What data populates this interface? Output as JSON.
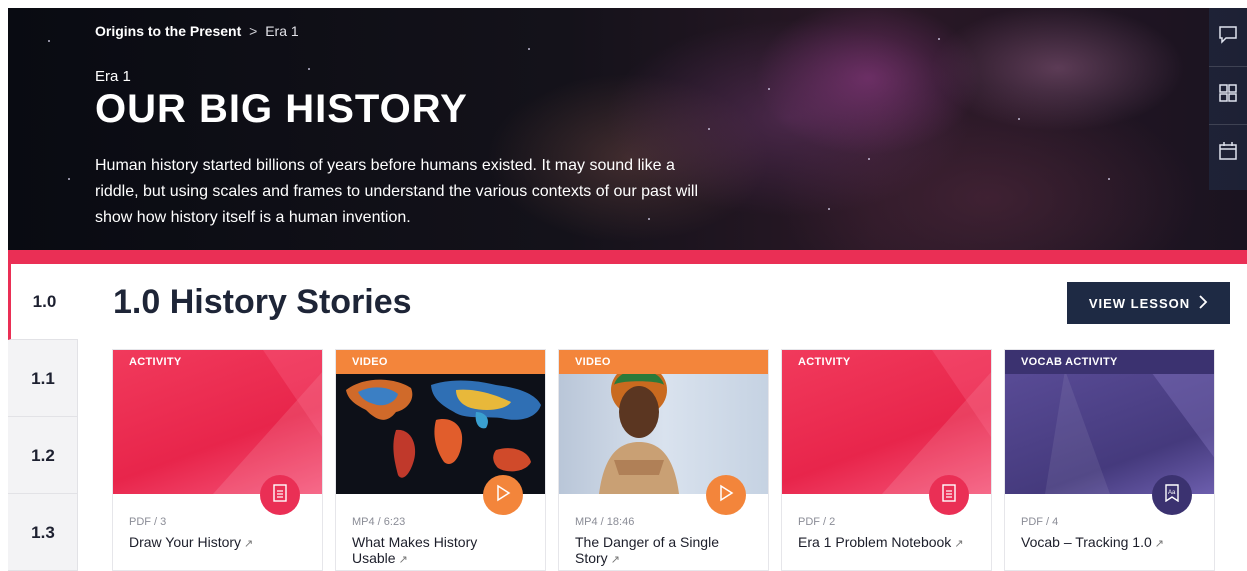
{
  "breadcrumb": {
    "parent": "Origins to the Present",
    "separator": ">",
    "current": "Era 1"
  },
  "hero": {
    "era_label": "Era 1",
    "title": "OUR BIG HISTORY",
    "description": "Human history started billions of years before humans existed. It may sound like a riddle, but using scales and frames to understand the various contexts of our past will show how history itself is a human invention."
  },
  "tools": [
    {
      "icon": "chat-icon"
    },
    {
      "icon": "grid-icon"
    },
    {
      "icon": "calendar-icon"
    }
  ],
  "sidebar": {
    "tabs": [
      {
        "label": "1.0",
        "active": true
      },
      {
        "label": "1.1",
        "active": false
      },
      {
        "label": "1.2",
        "active": false
      },
      {
        "label": "1.3",
        "active": false
      }
    ]
  },
  "section": {
    "title": "1.0 History Stories",
    "view_lesson_label": "VIEW LESSON"
  },
  "cards": [
    {
      "type": "ACTIVITY",
      "meta": "PDF / 3",
      "title": "Draw Your History",
      "action_icon": "document-icon",
      "color": "#ea2f55"
    },
    {
      "type": "VIDEO",
      "meta": "MP4 / 6:23",
      "title": "What Makes History Usable",
      "action_icon": "play-icon",
      "color": "#f3853b"
    },
    {
      "type": "VIDEO",
      "meta": "MP4 / 18:46",
      "title": "The Danger of a Single Story",
      "action_icon": "play-icon",
      "color": "#f3853b"
    },
    {
      "type": "ACTIVITY",
      "meta": "PDF / 2",
      "title": "Era 1 Problem Notebook",
      "action_icon": "document-icon",
      "color": "#ea2f55"
    },
    {
      "type": "VOCAB ACTIVITY",
      "meta": "PDF / 4",
      "title": "Vocab – Tracking 1.0",
      "action_icon": "vocab-icon",
      "color": "#3b3270"
    }
  ],
  "colors": {
    "accent_pink": "#ea2f55",
    "navy": "#1e2a44",
    "orange": "#f3853b",
    "purple": "#3b3270"
  }
}
